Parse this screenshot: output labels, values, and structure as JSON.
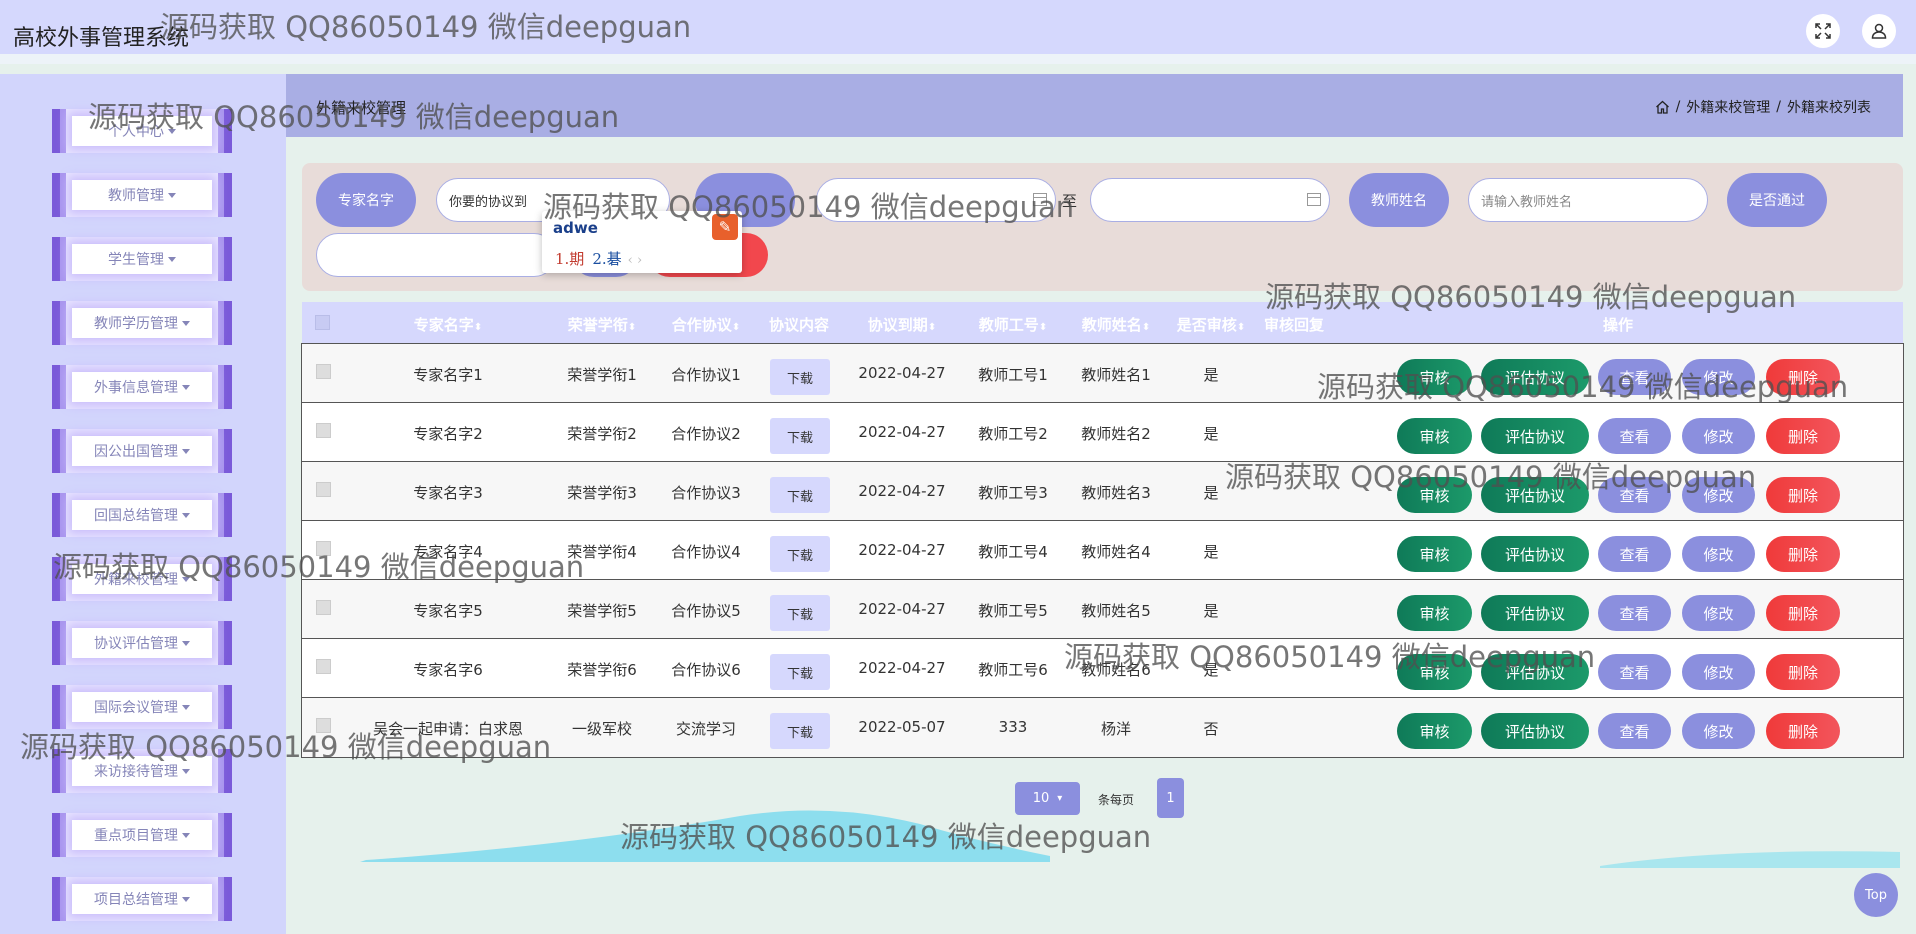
{
  "app": {
    "title": "高校外事管理系统"
  },
  "topbar": {
    "fullscreen_icon": "fullscreen-icon",
    "user_icon": "user-icon"
  },
  "sidebar": {
    "items": [
      {
        "label": "个人中心"
      },
      {
        "label": "教师管理"
      },
      {
        "label": "学生管理"
      },
      {
        "label": "教师学历管理"
      },
      {
        "label": "外事信息管理"
      },
      {
        "label": "因公出国管理"
      },
      {
        "label": "回国总结管理"
      },
      {
        "label": "外籍来校管理"
      },
      {
        "label": "协议评估管理"
      },
      {
        "label": "国际会议管理"
      },
      {
        "label": "来访接待管理"
      },
      {
        "label": "重点项目管理"
      },
      {
        "label": "项目总结管理"
      }
    ]
  },
  "header": {
    "title": "外籍来校管理",
    "breadcrumb": [
      "外籍来校管理",
      "外籍来校列表"
    ],
    "home_icon": "home-icon"
  },
  "search": {
    "expert_name_label": "专家名字",
    "agreement_value": "你要的协议到",
    "date_after_label": "至",
    "teacher_name_label": "教师姓名",
    "teacher_name_placeholder": "请输入教师姓名",
    "approved_label": "是否通过"
  },
  "ime": {
    "typed": "adwe",
    "candidate_1": "1.期",
    "candidate_2": "2.碁",
    "arrows": "‹ ›"
  },
  "table": {
    "headers": {
      "expert_name": "专家名字",
      "honor_title": "荣誉学衔",
      "agreement": "合作协议",
      "content": "协议内容",
      "due_date": "协议到期",
      "teacher_no": "教师工号",
      "teacher_name": "教师姓名",
      "audited": "是否审核",
      "audit_reply": "审核回复",
      "actions": "操作"
    },
    "rows": [
      {
        "expert_name": "专家名字1",
        "honor_title": "荣誉学衔1",
        "agreement": "合作协议1",
        "download": "下载",
        "due_date": "2022-04-27",
        "teacher_no": "教师工号1",
        "teacher_name": "教师姓名1",
        "audited": "是"
      },
      {
        "expert_name": "专家名字2",
        "honor_title": "荣誉学衔2",
        "agreement": "合作协议2",
        "download": "下载",
        "due_date": "2022-04-27",
        "teacher_no": "教师工号2",
        "teacher_name": "教师姓名2",
        "audited": "是"
      },
      {
        "expert_name": "专家名字3",
        "honor_title": "荣誉学衔3",
        "agreement": "合作协议3",
        "download": "下载",
        "due_date": "2022-04-27",
        "teacher_no": "教师工号3",
        "teacher_name": "教师姓名3",
        "audited": "是"
      },
      {
        "expert_name": "专家名字4",
        "honor_title": "荣誉学衔4",
        "agreement": "合作协议4",
        "download": "下载",
        "due_date": "2022-04-27",
        "teacher_no": "教师工号4",
        "teacher_name": "教师姓名4",
        "audited": "是"
      },
      {
        "expert_name": "专家名字5",
        "honor_title": "荣誉学衔5",
        "agreement": "合作协议5",
        "download": "下载",
        "due_date": "2022-04-27",
        "teacher_no": "教师工号5",
        "teacher_name": "教师姓名5",
        "audited": "是"
      },
      {
        "expert_name": "专家名字6",
        "honor_title": "荣誉学衔6",
        "agreement": "合作协议6",
        "download": "下载",
        "due_date": "2022-04-27",
        "teacher_no": "教师工号6",
        "teacher_name": "教师姓名6",
        "audited": "是"
      },
      {
        "expert_name": "吴会一起申请：白求恩",
        "honor_title": "一级军校",
        "agreement": "交流学习",
        "download": "下载",
        "due_date": "2022-05-07",
        "teacher_no": "333",
        "teacher_name": "杨洋",
        "audited": "否"
      }
    ],
    "actions": {
      "audit": "审核",
      "evaluate": "评估协议",
      "view": "查看",
      "edit": "修改",
      "delete": "删除"
    }
  },
  "pagination": {
    "page_size": "10",
    "page_size_label": "条每页",
    "current_page": "1"
  },
  "back_to_top": "Top",
  "watermark": "源码获取 QQ86050149 微信deepguan",
  "colors": {
    "primary": "#8b8fde",
    "green": "#158a5f",
    "red": "#f2474d",
    "topbar": "#d5d8fd",
    "sidebar": "#d2d5fc"
  }
}
